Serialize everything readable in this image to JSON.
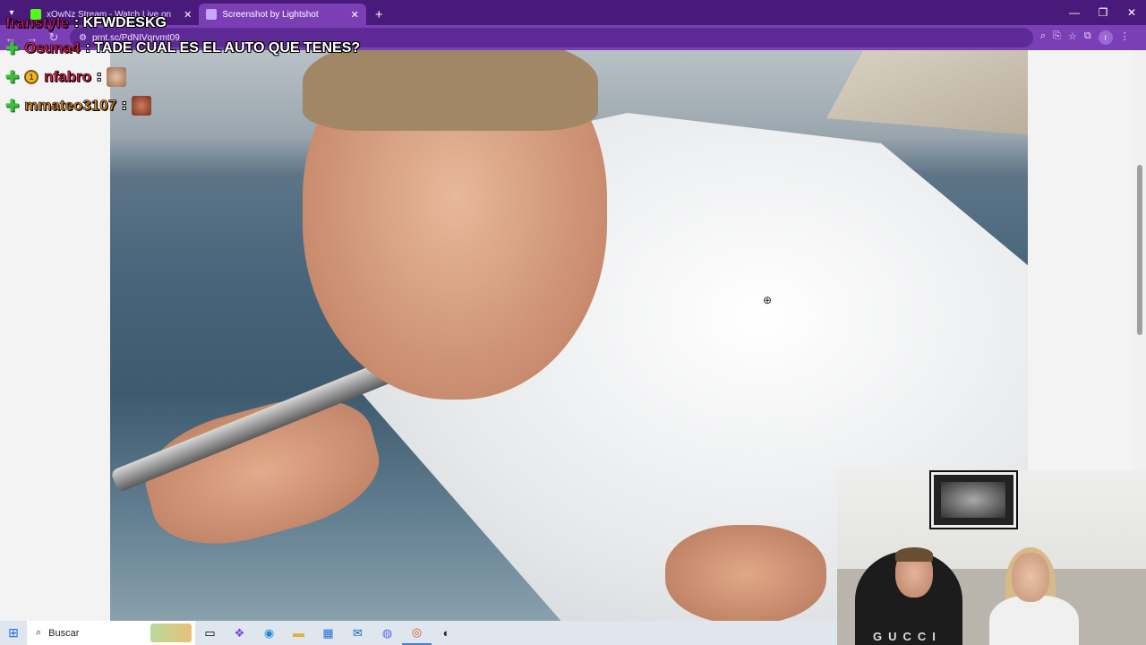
{
  "browser": {
    "tabs": [
      {
        "title": "xOwNz Stream - Watch Live on",
        "icon_color": "#53fc18",
        "active": false
      },
      {
        "title": "Screenshot by Lightshot",
        "icon_color": "#c9a6ff",
        "active": true
      }
    ],
    "url": "prnt.sc/PdNIVqrvmt09",
    "new_tab_label": "+",
    "profile_initial": "I"
  },
  "chat": {
    "messages": [
      {
        "user": "franstyle",
        "user_color": "#c21b74",
        "text": ": KFWDESKG"
      },
      {
        "user": "Osuna4",
        "user_color": "#e0204a",
        "text": ": TADE CUAL ES EL AUTO QUE TENES?"
      },
      {
        "user": "nfabro",
        "user_color": "#e0204a",
        "text": ":"
      },
      {
        "user": "mmateo3107",
        "user_color": "#d98a2a",
        "text": ":"
      }
    ]
  },
  "webcam": {
    "shirt_text": "GUCCI"
  },
  "taskbar": {
    "search_placeholder": "Buscar",
    "apps": [
      "task-view-icon",
      "copilot-icon",
      "edge-icon",
      "file-explorer-icon",
      "store-icon",
      "outlook-icon",
      "discord-icon",
      "chrome-icon",
      "obs-icon"
    ]
  },
  "colors": {
    "tabbar": "#4a1a7a",
    "addressbar": "#7b3fb5"
  }
}
